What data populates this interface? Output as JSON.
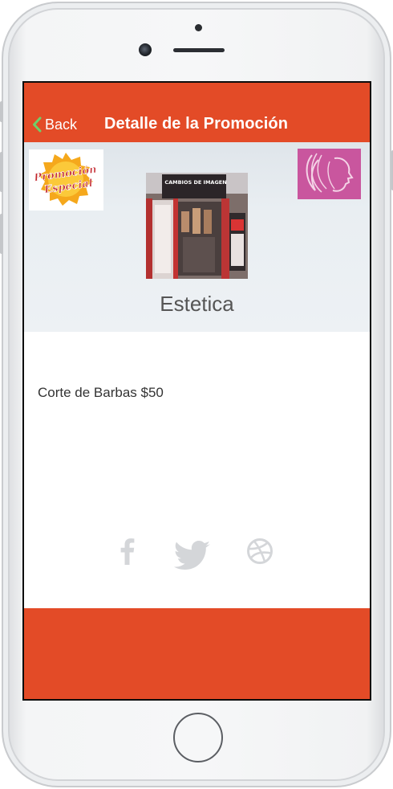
{
  "colors": {
    "brand": "#e34b27",
    "text": "#333333",
    "muted_icon": "#d4d6d9"
  },
  "header": {
    "back_label": "Back",
    "title": "Detalle de la Promoción"
  },
  "hero": {
    "promo_badge_text_line1": "Promoción",
    "promo_badge_text_line2": "Especial",
    "store_sign": "CAMBIOS DE IMAGEN",
    "store_name": "Estetica"
  },
  "promotion": {
    "description": "Corte de Barbas $50"
  },
  "social_icons": [
    "facebook-icon",
    "twitter-icon",
    "dribbble-icon"
  ]
}
